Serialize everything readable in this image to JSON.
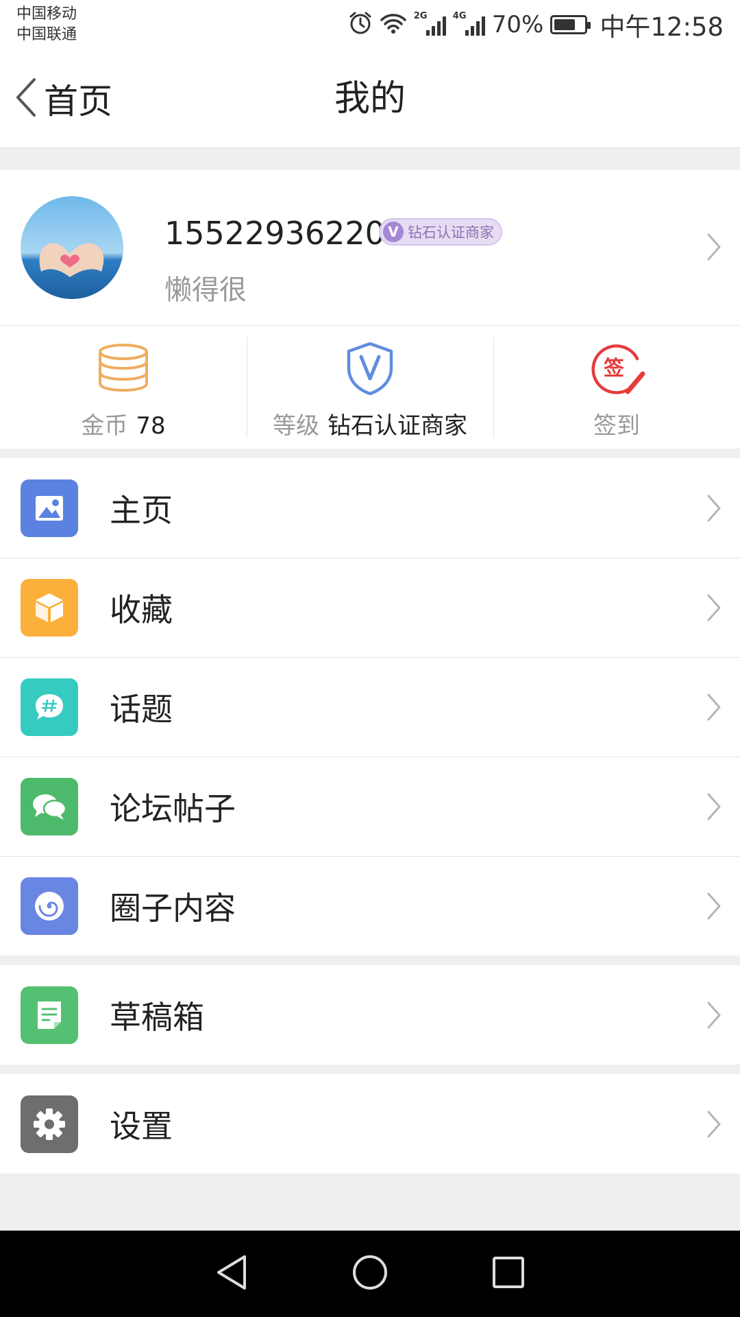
{
  "status_bar": {
    "carrier_1": "中国移动",
    "carrier_2": "中国联通",
    "signal_1_label": "2G",
    "signal_2_label": "4G",
    "battery_percent": "70%",
    "battery_level": 0.7,
    "time": "中午12:58",
    "icons": [
      "alarm-icon",
      "wifi-icon",
      "signal-icon",
      "battery-icon"
    ]
  },
  "nav": {
    "back_label": "首页",
    "title": "我的"
  },
  "profile": {
    "phone": "15522936220",
    "badge_letter": "V",
    "badge_text": "钻石认证商家",
    "bio": "懒得很"
  },
  "stats": {
    "coins_label": "金币",
    "coins_value": "78",
    "level_label": "等级",
    "level_value": "钻石认证商家",
    "signin_label": "签到",
    "signin_icon_char": "签"
  },
  "menu": {
    "group1": [
      {
        "label": "主页",
        "icon": "image-icon",
        "color": "#5b82e0"
      },
      {
        "label": "收藏",
        "icon": "box-icon",
        "color": "#fbb03b"
      },
      {
        "label": "话题",
        "icon": "hashtag-chat-icon",
        "color": "#36cbc0"
      },
      {
        "label": "论坛帖子",
        "icon": "chat-bubbles-icon",
        "color": "#4cba6a"
      },
      {
        "label": "圈子内容",
        "icon": "spiral-icon",
        "color": "#6a86e3"
      }
    ],
    "group2": [
      {
        "label": "草稿箱",
        "icon": "draft-note-icon",
        "color": "#54c071"
      }
    ],
    "group3": [
      {
        "label": "设置",
        "icon": "gear-icon",
        "color": "#6e6e6e"
      }
    ]
  },
  "colors": {
    "accent_gold": "#f0ac5e",
    "accent_blue": "#5f8de0",
    "accent_red": "#e53b3b",
    "badge_purple": "#a587d6"
  }
}
